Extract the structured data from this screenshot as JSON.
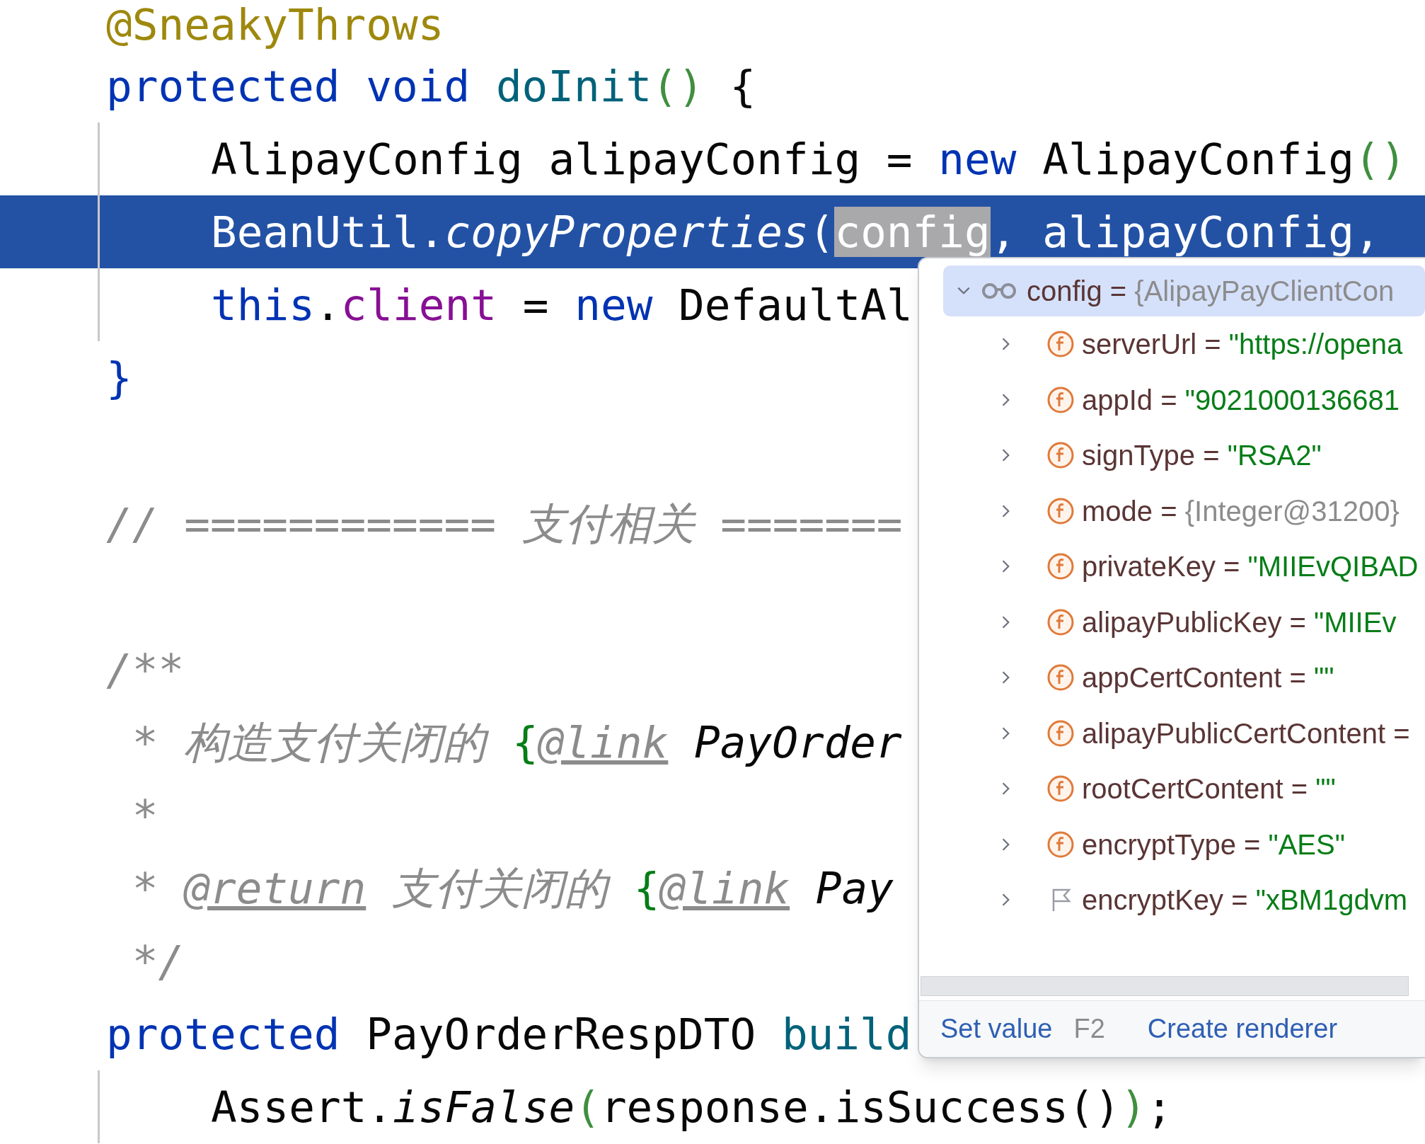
{
  "editor": {
    "blocks": [
      [
        {
          "highlighted": false,
          "tokens": [
            {
              "text": "@SneakyThrows",
              "kind": "annotation"
            }
          ]
        },
        {
          "highlighted": false,
          "tokens": [
            {
              "text": "protected void ",
              "kind": "keyword"
            },
            {
              "text": "doInit",
              "kind": "declaration"
            },
            {
              "text": "()",
              "kind": "paren"
            },
            {
              "text": " {",
              "kind": "plain"
            }
          ],
          "children": [
            {
              "highlighted": false,
              "tokens": [
                {
                  "text": "AlipayConfig alipayConfig = ",
                  "kind": "plain"
                },
                {
                  "text": "new ",
                  "kind": "keyword"
                },
                {
                  "text": "AlipayConfig",
                  "kind": "plain"
                },
                {
                  "text": "()",
                  "kind": "paren"
                }
              ]
            },
            {
              "highlighted": true,
              "tokens": [
                {
                  "text": "BeanUtil.",
                  "kind": "plain"
                },
                {
                  "text": "copyProperties",
                  "kind": "static"
                },
                {
                  "text": "(",
                  "kind": "plain"
                },
                {
                  "text": "config",
                  "kind": "plain",
                  "selected": true
                },
                {
                  "text": ", alipayConfig,",
                  "kind": "plain"
                }
              ]
            },
            {
              "highlighted": false,
              "tokens": [
                {
                  "text": "this",
                  "kind": "keyword"
                },
                {
                  "text": ".",
                  "kind": "plain"
                },
                {
                  "text": "client",
                  "kind": "field"
                },
                {
                  "text": " = ",
                  "kind": "plain"
                },
                {
                  "text": "new ",
                  "kind": "keyword"
                },
                {
                  "text": "DefaultAl",
                  "kind": "plain"
                }
              ]
            }
          ]
        },
        {
          "highlighted": false,
          "tokens": [
            {
              "text": "}",
              "kind": "keyword"
            }
          ]
        }
      ],
      [
        {
          "highlighted": false,
          "tokens": [
            {
              "text": "// ============ 支付相关 =======",
              "kind": "comment"
            }
          ]
        }
      ],
      [
        {
          "highlighted": false,
          "tokens": [
            {
              "text": "/**",
              "kind": "comment"
            }
          ]
        },
        {
          "highlighted": false,
          "tokens": [
            {
              "text": " * 构造支付关闭的 ",
              "kind": "comment"
            },
            {
              "text": "{",
              "kind": "doc_brace"
            },
            {
              "text": "@link",
              "kind": "doc_tag"
            },
            {
              "text": " PayOrder",
              "kind": "doc_ref"
            }
          ]
        },
        {
          "highlighted": false,
          "tokens": [
            {
              "text": " *",
              "kind": "comment"
            }
          ]
        },
        {
          "highlighted": false,
          "tokens": [
            {
              "text": " * ",
              "kind": "comment"
            },
            {
              "text": "@return",
              "kind": "doc_tag"
            },
            {
              "text": " 支付关闭的 ",
              "kind": "comment"
            },
            {
              "text": "{",
              "kind": "doc_brace"
            },
            {
              "text": "@link",
              "kind": "doc_tag"
            },
            {
              "text": " Pay",
              "kind": "doc_ref"
            }
          ]
        },
        {
          "highlighted": false,
          "tokens": [
            {
              "text": " */",
              "kind": "comment"
            }
          ]
        },
        {
          "highlighted": false,
          "tokens": [
            {
              "text": "protected ",
              "kind": "keyword"
            },
            {
              "text": "PayOrderRespDTO ",
              "kind": "plain"
            },
            {
              "text": "build",
              "kind": "declaration"
            }
          ],
          "children": [
            {
              "highlighted": false,
              "tokens": [
                {
                  "text": "Assert.",
                  "kind": "plain"
                },
                {
                  "text": "isFalse",
                  "kind": "static"
                },
                {
                  "text": "(",
                  "kind": "paren"
                },
                {
                  "text": "response.isSuccess",
                  "kind": "plain"
                },
                {
                  "text": "()",
                  "kind": "plain"
                },
                {
                  "text": ")",
                  "kind": "paren"
                },
                {
                  "text": ";",
                  "kind": "plain"
                }
              ]
            }
          ]
        }
      ]
    ]
  },
  "debugger_popup": {
    "root": {
      "name": "config",
      "sign": "=",
      "value": "{AlipayPayClientCon",
      "expanded": true,
      "selected": true
    },
    "fields": [
      {
        "kind": "field",
        "name": "serverUrl",
        "sign": "=",
        "value": {
          "kind": "string",
          "text": "\"https://opena"
        }
      },
      {
        "kind": "field",
        "name": "appId",
        "sign": "=",
        "value": {
          "kind": "string",
          "text": "\"9021000136681"
        }
      },
      {
        "kind": "field",
        "name": "signType",
        "sign": "=",
        "value": {
          "kind": "string",
          "text": "\"RSA2\""
        }
      },
      {
        "kind": "field",
        "name": "mode",
        "sign": "=",
        "value": {
          "kind": "object",
          "text": "{Integer@31200}"
        }
      },
      {
        "kind": "field",
        "name": "privateKey",
        "sign": "=",
        "value": {
          "kind": "string",
          "text": "\"MIIEvQIBAD"
        }
      },
      {
        "kind": "field",
        "name": "alipayPublicKey",
        "sign": "=",
        "value": {
          "kind": "string",
          "text": "\"MIIEv"
        }
      },
      {
        "kind": "field",
        "name": "appCertContent",
        "sign": "=",
        "value": {
          "kind": "string",
          "text": "\"\""
        }
      },
      {
        "kind": "field",
        "name": "alipayPublicCertContent",
        "sign": "="
      },
      {
        "kind": "field",
        "name": "rootCertContent",
        "sign": "=",
        "value": {
          "kind": "string",
          "text": "\"\""
        }
      },
      {
        "kind": "field",
        "name": "encryptType",
        "sign": "=",
        "value": {
          "kind": "string",
          "text": "\"AES\""
        }
      },
      {
        "kind": "flag",
        "name": "encryptKey",
        "sign": "=",
        "value": {
          "kind": "string",
          "text": "\"xBM1gdvm"
        }
      }
    ],
    "actions": [
      {
        "label": "Set value",
        "shortcut": "F2"
      },
      {
        "label": "Create renderer"
      }
    ]
  }
}
